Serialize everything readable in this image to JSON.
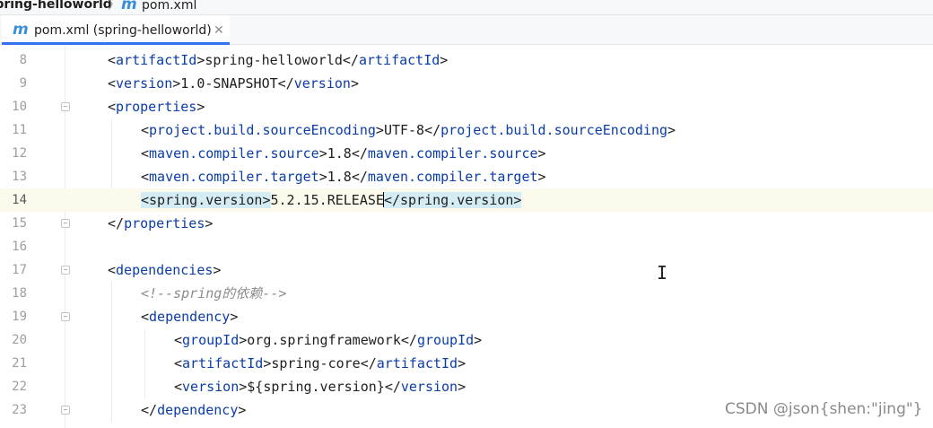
{
  "breadcrumb": {
    "project": "spring-helloworld",
    "separator": "〉",
    "icon_glyph": "m",
    "file": "pom.xml"
  },
  "tab": {
    "icon_glyph": "m",
    "title": "pom.xml (spring-helloworld)",
    "close_glyph": "✕"
  },
  "editor": {
    "current_line": 14,
    "lines": [
      {
        "n": "8",
        "parts": [
          {
            "t": "<",
            "c": "br"
          },
          {
            "t": "artifactId",
            "c": "tg"
          },
          {
            "t": ">",
            "c": "br"
          },
          {
            "t": "spring-helloworld",
            "c": "tx"
          },
          {
            "t": "</",
            "c": "br"
          },
          {
            "t": "artifactId",
            "c": "tg"
          },
          {
            "t": ">",
            "c": "br"
          }
        ]
      },
      {
        "n": "9",
        "parts": [
          {
            "t": "<",
            "c": "br"
          },
          {
            "t": "version",
            "c": "tg"
          },
          {
            "t": ">",
            "c": "br"
          },
          {
            "t": "1.0-SNAPSHOT",
            "c": "tx"
          },
          {
            "t": "</",
            "c": "br"
          },
          {
            "t": "version",
            "c": "tg"
          },
          {
            "t": ">",
            "c": "br"
          }
        ]
      },
      {
        "n": "10",
        "parts": [
          {
            "t": "<",
            "c": "br"
          },
          {
            "t": "properties",
            "c": "tg"
          },
          {
            "t": ">",
            "c": "br"
          }
        ]
      },
      {
        "n": "11",
        "parts": [
          {
            "t": "<",
            "c": "br"
          },
          {
            "t": "project.build.sourceEncoding",
            "c": "tg"
          },
          {
            "t": ">",
            "c": "br"
          },
          {
            "t": "UTF-8",
            "c": "tx"
          },
          {
            "t": "</",
            "c": "br"
          },
          {
            "t": "project.build.sourceEncoding",
            "c": "tg"
          },
          {
            "t": ">",
            "c": "br"
          }
        ]
      },
      {
        "n": "12",
        "parts": [
          {
            "t": "<",
            "c": "br"
          },
          {
            "t": "maven.compiler.source",
            "c": "tg"
          },
          {
            "t": ">",
            "c": "br"
          },
          {
            "t": "1.8",
            "c": "tx"
          },
          {
            "t": "</",
            "c": "br"
          },
          {
            "t": "maven.compiler.source",
            "c": "tg"
          },
          {
            "t": ">",
            "c": "br"
          }
        ]
      },
      {
        "n": "13",
        "parts": [
          {
            "t": "<",
            "c": "br"
          },
          {
            "t": "maven.compiler.target",
            "c": "tg"
          },
          {
            "t": ">",
            "c": "br"
          },
          {
            "t": "1.8",
            "c": "tx"
          },
          {
            "t": "</",
            "c": "br"
          },
          {
            "t": "maven.compiler.target",
            "c": "tg"
          },
          {
            "t": ">",
            "c": "br"
          }
        ]
      },
      {
        "n": "14",
        "parts": [
          {
            "t": "<spring.version>",
            "c": "hl"
          },
          {
            "t": "5.2.15.RELEASE",
            "c": "tx"
          },
          {
            "t": "",
            "c": "caret"
          },
          {
            "t": "</spring.version>",
            "c": "hl"
          }
        ]
      },
      {
        "n": "15",
        "parts": [
          {
            "t": "</",
            "c": "br"
          },
          {
            "t": "properties",
            "c": "tg"
          },
          {
            "t": ">",
            "c": "br"
          }
        ]
      },
      {
        "n": "16",
        "parts": []
      },
      {
        "n": "17",
        "parts": [
          {
            "t": "<",
            "c": "br"
          },
          {
            "t": "dependencies",
            "c": "tg"
          },
          {
            "t": ">",
            "c": "br"
          }
        ]
      },
      {
        "n": "18",
        "parts": [
          {
            "t": "<!--spring的依赖-->",
            "c": "cm"
          }
        ]
      },
      {
        "n": "19",
        "parts": [
          {
            "t": "<",
            "c": "br"
          },
          {
            "t": "dependency",
            "c": "tg"
          },
          {
            "t": ">",
            "c": "br"
          }
        ]
      },
      {
        "n": "20",
        "parts": [
          {
            "t": "<",
            "c": "br"
          },
          {
            "t": "groupId",
            "c": "tg"
          },
          {
            "t": ">",
            "c": "br"
          },
          {
            "t": "org.springframework",
            "c": "tx"
          },
          {
            "t": "</",
            "c": "br"
          },
          {
            "t": "groupId",
            "c": "tg"
          },
          {
            "t": ">",
            "c": "br"
          }
        ]
      },
      {
        "n": "21",
        "parts": [
          {
            "t": "<",
            "c": "br"
          },
          {
            "t": "artifactId",
            "c": "tg"
          },
          {
            "t": ">",
            "c": "br"
          },
          {
            "t": "spring-core",
            "c": "tx"
          },
          {
            "t": "</",
            "c": "br"
          },
          {
            "t": "artifactId",
            "c": "tg"
          },
          {
            "t": ">",
            "c": "br"
          }
        ]
      },
      {
        "n": "22",
        "parts": [
          {
            "t": "<",
            "c": "br"
          },
          {
            "t": "version",
            "c": "tg"
          },
          {
            "t": ">",
            "c": "br"
          },
          {
            "t": "${spring.version}",
            "c": "tx"
          },
          {
            "t": "</",
            "c": "br"
          },
          {
            "t": "version",
            "c": "tg"
          },
          {
            "t": ">",
            "c": "br"
          }
        ]
      },
      {
        "n": "23",
        "parts": [
          {
            "t": "</",
            "c": "br"
          },
          {
            "t": "dependency",
            "c": "tg"
          },
          {
            "t": ">",
            "c": "br"
          }
        ]
      }
    ]
  },
  "watermark": "CSDN @json{shen:\"jing\"}",
  "colors": {
    "tag": "#0a3da8",
    "text": "#1e1e1e",
    "comment": "#8c8c8c",
    "current_line": "#fcfaed",
    "tag_highlight": "#d4ecf4",
    "tab_accent": "#3574f0",
    "maven_icon": "#3a8fd9"
  }
}
